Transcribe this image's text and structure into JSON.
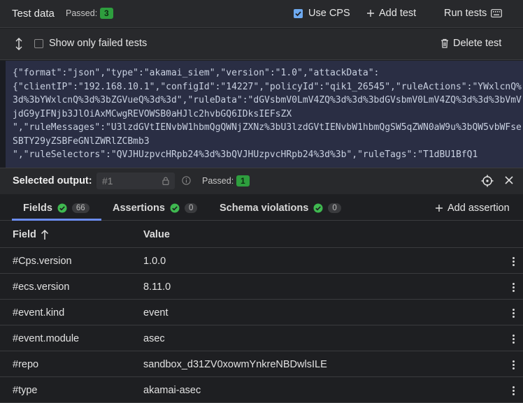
{
  "topbar": {
    "title": "Test data",
    "passed_label": "Passed:",
    "passed_count": "3",
    "use_cps_label": "Use CPS",
    "use_cps_checked": true,
    "add_test_label": "Add test",
    "run_tests_label": "Run tests"
  },
  "subbar": {
    "show_failed_label": "Show only failed tests",
    "delete_test_label": "Delete test"
  },
  "code": {
    "text": "{\"format\":\"json\",\"type\":\"akamai_siem\",\"version\":\"1.0\",\"attackData\":\n{\"clientIP\":\"192.168.10.1\",\"configId\":\"14227\",\"policyId\":\"qik1_26545\",\"ruleActions\":\"YWxlcnQ%3d%3bYWxlcnQ%3d%3bZGVueQ%3d%3d\",\"ruleData\":\"dGVsbmV0LmV4ZQ%3d%3d%3bdGVsbmV0LmV4ZQ%3d%3d%3bVmVjdG9yIFNjb3JlOiAxMCwgREVOWSB0aHJlc2hvbGQ6IDksIEFsZX\n\",\"ruleMessages\":\"U3lzdGVtIENvbW1hbmQgQWNjZXNz%3bU3lzdGVtIENvbW1hbmQgSW5qZWN0aW9u%3bQW5vbWFseSBTY29yZSBFeGNlZWRlZCBmb3\n\",\"ruleSelectors\":\"QVJHUzpvcHRpb24%3d%3bQVJHUzpvcHRpb24%3d%3b\",\"ruleTags\":\"T1dBU1BfQ1"
  },
  "selected_output": {
    "label": "Selected output:",
    "placeholder": "#1",
    "passed_label": "Passed:",
    "passed_count": "1"
  },
  "tabs": [
    {
      "label": "Fields",
      "count": "66",
      "active": true
    },
    {
      "label": "Assertions",
      "count": "0",
      "active": false
    },
    {
      "label": "Schema violations",
      "count": "0",
      "active": false
    }
  ],
  "add_assertion_label": "Add assertion",
  "table": {
    "col_field": "Field",
    "col_value": "Value",
    "rows": [
      {
        "field": "#Cps.version",
        "value": "1.0.0"
      },
      {
        "field": "#ecs.version",
        "value": "8.11.0"
      },
      {
        "field": "#event.kind",
        "value": "event"
      },
      {
        "field": "#event.module",
        "value": "asec"
      },
      {
        "field": "#repo",
        "value": "sandbox_d31ZV0xowmYnkreNBDwlsILE"
      },
      {
        "field": "#type",
        "value": "akamai-asec"
      }
    ]
  },
  "colors": {
    "passed_badge": "#2e9e3e",
    "checkbox_on": "#6ea9ef",
    "tab_underline": "#6b8cf0",
    "code_bg": "#2a2e44",
    "bg": "#1e1f22"
  }
}
